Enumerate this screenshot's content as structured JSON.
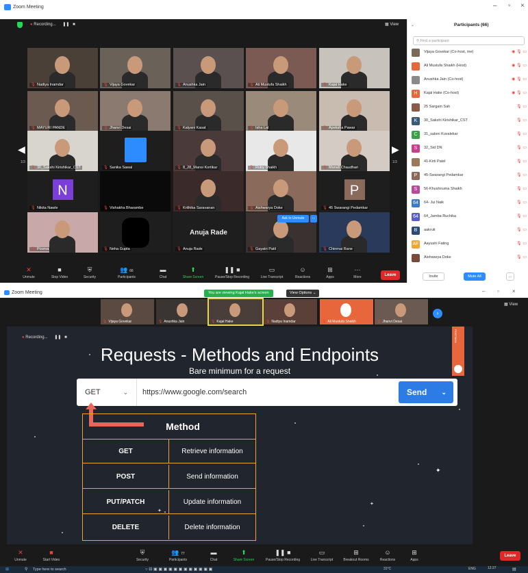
{
  "win1": {
    "title": "Zoom Meeting",
    "recording": "Recording...",
    "view": "View",
    "page_left": "1/3",
    "page_right": "1/3",
    "tiles": [
      {
        "name": "Nadiya Inamdar"
      },
      {
        "name": "Vijaya Govekar"
      },
      {
        "name": "Anushka Jain"
      },
      {
        "name": "Ali Mustufa Shaikh"
      },
      {
        "name": "Kajal Hake"
      },
      {
        "name": "MAYURI PANDE"
      },
      {
        "name": "Jhanvi Desai"
      },
      {
        "name": "Kalyani Kasat"
      },
      {
        "name": "Isha Lal"
      },
      {
        "name": "Apeksha Pawar"
      },
      {
        "name": "30_Sakshi Kirishikar_CST"
      },
      {
        "name": "Sanika Sawal"
      },
      {
        "name": "8_28_Mansi Kortikar"
      },
      {
        "name": "Ruby Shaikh"
      },
      {
        "name": "Manali Chaudhari"
      },
      {
        "name": "Nikita Nawle",
        "letter": "N"
      },
      {
        "name": "Vishakha Bharambe"
      },
      {
        "name": "Krithika Saravanan"
      },
      {
        "name": "Aishwarya Doke"
      },
      {
        "name": "45 Swarangi Pedamkar",
        "letter": "P"
      },
      {
        "name": "Poorva"
      },
      {
        "name": "Neha Gupta"
      },
      {
        "name": "Anuja Rade",
        "center": "Anuja Rade"
      },
      {
        "name": "Gayatri Patil"
      },
      {
        "name": "Chinmai Rane"
      }
    ],
    "ask_unmute": "Ask to Unmute",
    "ask_more": "...",
    "toolbar": {
      "unmute": "Unmute",
      "stop_video": "Stop Video",
      "security": "Security",
      "participants": "Participants",
      "participants_count": "66",
      "chat": "Chat",
      "share_screen": "Share Screen",
      "pause_rec": "Pause/Stop Recording",
      "live_transcript": "Live Transcript",
      "reactions": "Reactions",
      "apps": "Apps",
      "more": "More",
      "leave": "Leave"
    },
    "panel": {
      "title": "Participants (66)",
      "search_placeholder": "Find a participant",
      "participants": [
        {
          "name": "Vijaya Govekar (Co-host, me)",
          "initial": "",
          "color": "#7a6a5a"
        },
        {
          "name": "Ali Mustufa Shaikh (Host)",
          "initial": "",
          "color": "#e8663b"
        },
        {
          "name": "Anushka Jain (Co-host)",
          "initial": "",
          "color": "#8a8a8a"
        },
        {
          "name": "Kajal Hake (Co-host)",
          "initial": "H",
          "color": "#e8663b"
        },
        {
          "name": "25 Sargam Sah",
          "initial": "",
          "color": "#8a5a4a"
        },
        {
          "name": "30_Sakshi Kirishikar_CST",
          "initial": "K",
          "color": "#3a5a7a"
        },
        {
          "name": "31_saloni Kuvalekar",
          "initial": "C",
          "color": "#3aa04a"
        },
        {
          "name": "32_Sid DN",
          "initial": "S",
          "color": "#c8408a"
        },
        {
          "name": "41-Kirti Patel",
          "initial": "",
          "color": "#9a7a5a"
        },
        {
          "name": "45-Swarangi Pedamkar",
          "initial": "P",
          "color": "#8a6a5a"
        },
        {
          "name": "56-Khushnuma Shaikh",
          "initial": "S",
          "color": "#b84a9a"
        },
        {
          "name": "64- Jui Naik",
          "initial": "64",
          "color": "#3a7ac8"
        },
        {
          "name": "64_Jamba Ruchika",
          "initial": "64",
          "color": "#5a5ac8"
        },
        {
          "name": "aakruti",
          "initial": "B",
          "color": "#2a4a7a"
        },
        {
          "name": "Aayushi Fating",
          "initial": "AF",
          "color": "#f0a530"
        },
        {
          "name": "Aishwarya Doke",
          "initial": "",
          "color": "#7a4a3a"
        }
      ],
      "invite": "Invite",
      "mute_all": "Mute All",
      "more": "..."
    }
  },
  "win2": {
    "title": "Zoom Meeting",
    "viewing": "You are viewing Kajal Hake's screen",
    "view_options": "View Options",
    "view": "View",
    "recording": "Recording...",
    "thumbs": [
      {
        "name": "Vijaya Govekar"
      },
      {
        "name": "Anushka Jain"
      },
      {
        "name": "Kajal Hake"
      },
      {
        "name": "Nadiya Inamdar"
      },
      {
        "name": "Ali Mustufa Shaikh"
      },
      {
        "name": "Jhanvi Desai"
      }
    ],
    "slide": {
      "title": "Requests - Methods and Endpoints",
      "subtitle": "Bare minimum for a request",
      "postman_tag": "POSTMAN",
      "method": "GET",
      "url": "https://www.google.com/search",
      "send": "Send",
      "table_title": "Method",
      "rows": [
        {
          "method": "GET",
          "desc": "Retrieve information"
        },
        {
          "method": "POST",
          "desc": "Send information"
        },
        {
          "method": "PUT/PATCH",
          "desc": "Update information"
        },
        {
          "method": "DELETE",
          "desc": "Delete information"
        }
      ]
    },
    "toolbar": {
      "unmute": "Unmute",
      "start_video": "Start Video",
      "security": "Security",
      "participants": "Participants",
      "participants_count": "77",
      "chat": "Chat",
      "share_screen": "Share Screen",
      "pause_rec": "Pause/Stop Recording",
      "live_transcript": "Live Transcript",
      "breakout": "Breakout Rooms",
      "reactions": "Reactions",
      "apps": "Apps",
      "leave": "Leave"
    },
    "taskbar": {
      "search": "Type here to search",
      "temp": "31°C",
      "lang": "ENG",
      "time": "12:27"
    }
  }
}
